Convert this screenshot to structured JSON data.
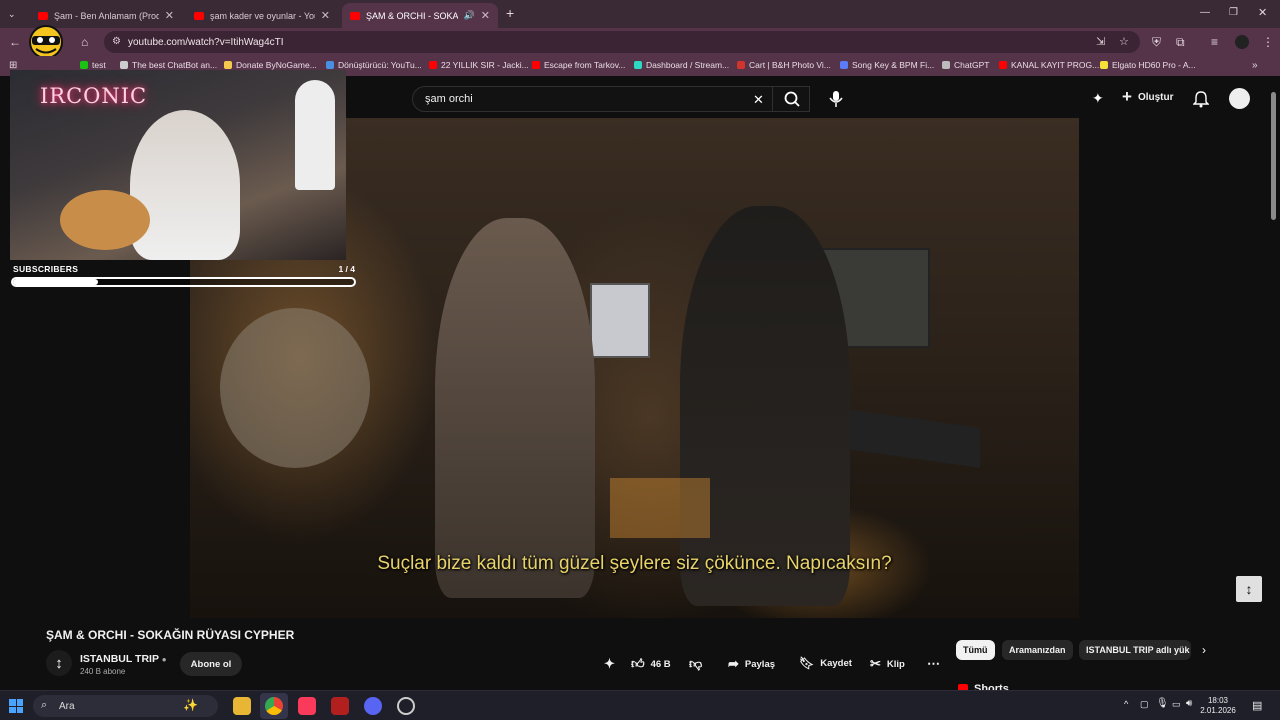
{
  "browser": {
    "tabs": [
      {
        "title": "Şam - Ben Anlamam (Prod. by d",
        "active": false
      },
      {
        "title": "şam kader ve oyunlar - YouTub",
        "active": false
      },
      {
        "title": "ŞAM & ORCHI - SOKAĞIN R",
        "active": true
      }
    ],
    "url": "youtube.com/watch?v=ItihWag4cTI",
    "bookmarks": [
      {
        "label": "test",
        "color": "#1ac313"
      },
      {
        "label": "The best ChatBot an...",
        "color": "#cccccc"
      },
      {
        "label": "Donate ByNoGame...",
        "color": "#f2c94c"
      },
      {
        "label": "Dönüştürücü: YouTu...",
        "color": "#4a90e2"
      },
      {
        "label": "22 YILLIK SIR - Jacki...",
        "color": "#ff0000"
      },
      {
        "label": "Escape from Tarkov...",
        "color": "#ff0000"
      },
      {
        "label": "Dashboard / Stream...",
        "color": "#2bd9c4"
      },
      {
        "label": "Cart | B&H Photo Vi...",
        "color": "#d0342c"
      },
      {
        "label": "Song Key & BPM Fi...",
        "color": "#5b7cfa"
      },
      {
        "label": "ChatGPT",
        "color": "#bbbbbb"
      },
      {
        "label": "KANAL KAYIT PROG...",
        "color": "#ff0000"
      },
      {
        "label": "Elgato HD60 Pro - A...",
        "color": "#f5e03a"
      }
    ]
  },
  "youtube": {
    "search_query": "şam orchi",
    "create_label": "Oluştur",
    "subtitle": "Suçlar bize kaldı tüm güzel şeylere siz çökünce. Napıcaksın?",
    "video_title": "ŞAM & ORCHI - SOKAĞIN RÜYASI CYPHER",
    "channel_name": "ISTANBUL TRIP",
    "channel_subs": "240 B abone",
    "subscribe_label": "Abone ol",
    "likes": "46 B",
    "share_label": "Paylaş",
    "save_label": "Kaydet",
    "clip_label": "Klip",
    "chips": [
      "Tümü",
      "Aramanızdan",
      "ISTANBUL TRIP adlı yük"
    ],
    "shorts_label": "Shorts"
  },
  "overlay": {
    "neon_text": "IRCONIC",
    "subs_label": "SUBSCRIBERS",
    "subs_count": "1 / 4",
    "subs_progress": 0.25
  },
  "taskbar": {
    "search_placeholder": "Ara",
    "time": "18:03",
    "date": "2.01.2026"
  },
  "colors": {
    "accent_red": "#ff0000",
    "subtitle_yellow": "#e8d36a",
    "chrome_frame": "#55344a"
  }
}
